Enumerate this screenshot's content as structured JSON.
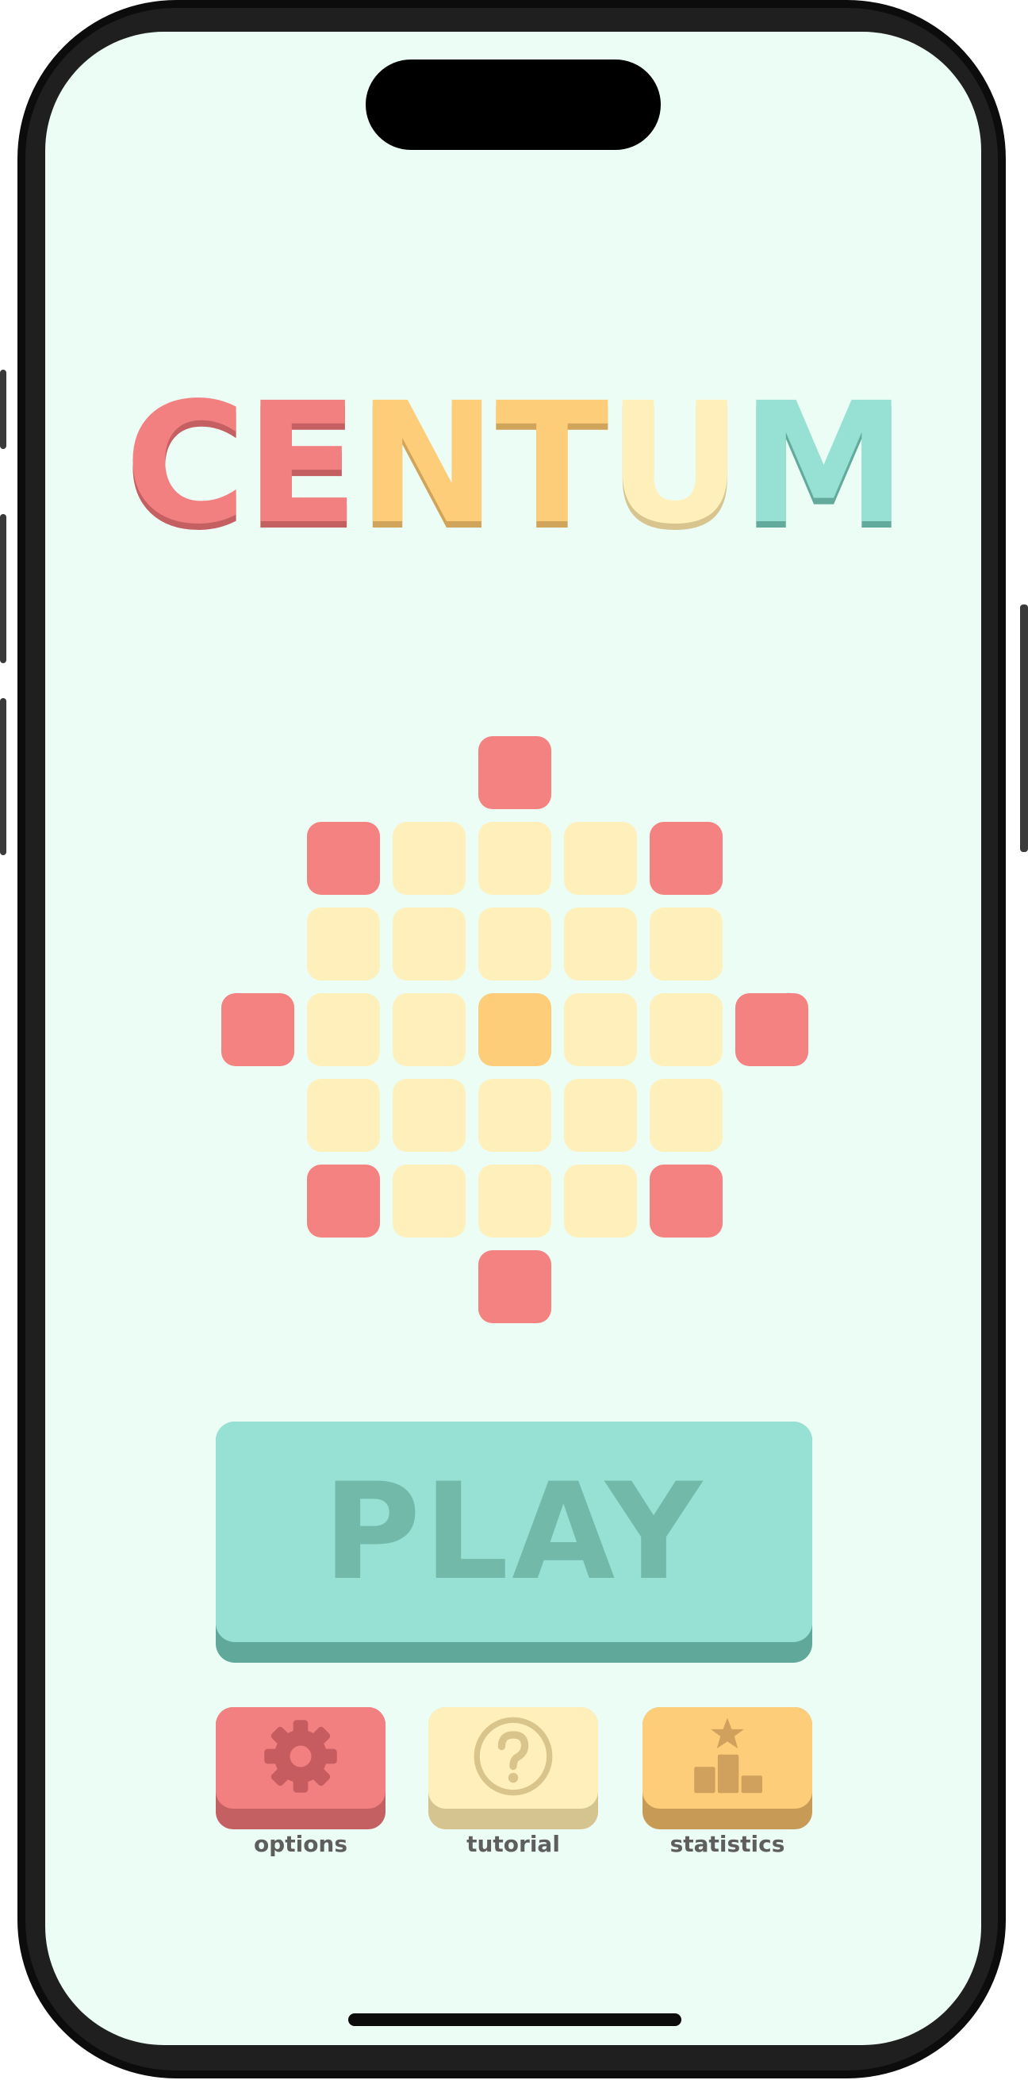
{
  "app": {
    "title_letters": [
      {
        "char": "C",
        "color": "#f28080",
        "shade": "#c45f62"
      },
      {
        "char": "E",
        "color": "#f28080",
        "shade": "#c45f62"
      },
      {
        "char": "N",
        "color": "#fecd7a",
        "shade": "#d0a45a"
      },
      {
        "char": "T",
        "color": "#fecd7a",
        "shade": "#d0a45a"
      },
      {
        "char": "U",
        "color": "#fff0bb",
        "shade": "#d7c48e"
      },
      {
        "char": "M",
        "color": "#96e1d3",
        "shade": "#62aa9b"
      }
    ]
  },
  "board": {
    "colors": {
      "edge": "#f48281",
      "cell": "#fff0bb",
      "highlight": "#fecd7a"
    },
    "tiles": [
      {
        "row": 0,
        "col": 3,
        "type": "edge"
      },
      {
        "row": 1,
        "col": 1,
        "type": "edge"
      },
      {
        "row": 1,
        "col": 2,
        "type": "cell"
      },
      {
        "row": 1,
        "col": 3,
        "type": "cell"
      },
      {
        "row": 1,
        "col": 4,
        "type": "cell"
      },
      {
        "row": 1,
        "col": 5,
        "type": "edge"
      },
      {
        "row": 2,
        "col": 1,
        "type": "cell"
      },
      {
        "row": 2,
        "col": 2,
        "type": "cell"
      },
      {
        "row": 2,
        "col": 3,
        "type": "cell"
      },
      {
        "row": 2,
        "col": 4,
        "type": "cell"
      },
      {
        "row": 2,
        "col": 5,
        "type": "cell"
      },
      {
        "row": 3,
        "col": 0,
        "type": "edge"
      },
      {
        "row": 3,
        "col": 1,
        "type": "cell"
      },
      {
        "row": 3,
        "col": 2,
        "type": "cell"
      },
      {
        "row": 3,
        "col": 3,
        "type": "highlight"
      },
      {
        "row": 3,
        "col": 4,
        "type": "cell"
      },
      {
        "row": 3,
        "col": 5,
        "type": "cell"
      },
      {
        "row": 3,
        "col": 6,
        "type": "edge"
      },
      {
        "row": 4,
        "col": 1,
        "type": "cell"
      },
      {
        "row": 4,
        "col": 2,
        "type": "cell"
      },
      {
        "row": 4,
        "col": 3,
        "type": "cell"
      },
      {
        "row": 4,
        "col": 4,
        "type": "cell"
      },
      {
        "row": 4,
        "col": 5,
        "type": "cell"
      },
      {
        "row": 5,
        "col": 1,
        "type": "edge"
      },
      {
        "row": 5,
        "col": 2,
        "type": "cell"
      },
      {
        "row": 5,
        "col": 3,
        "type": "cell"
      },
      {
        "row": 5,
        "col": 4,
        "type": "cell"
      },
      {
        "row": 5,
        "col": 5,
        "type": "edge"
      },
      {
        "row": 6,
        "col": 3,
        "type": "edge"
      }
    ]
  },
  "play_button": {
    "label": "PLAY"
  },
  "menu": {
    "options": {
      "label": "options",
      "icon": "gear-icon",
      "color": "#f28080",
      "shade": "#c45f62",
      "icon_color": "#c65c5f"
    },
    "tutorial": {
      "label": "tutorial",
      "icon": "question-circle-icon",
      "color": "#fff0bb",
      "shade": "#d6c490",
      "icon_color": "#d9c48c"
    },
    "statistics": {
      "label": "statistics",
      "icon": "podium-star-icon",
      "color": "#fecd7a",
      "shade": "#c79a56",
      "icon_color": "#cfa15d"
    }
  }
}
